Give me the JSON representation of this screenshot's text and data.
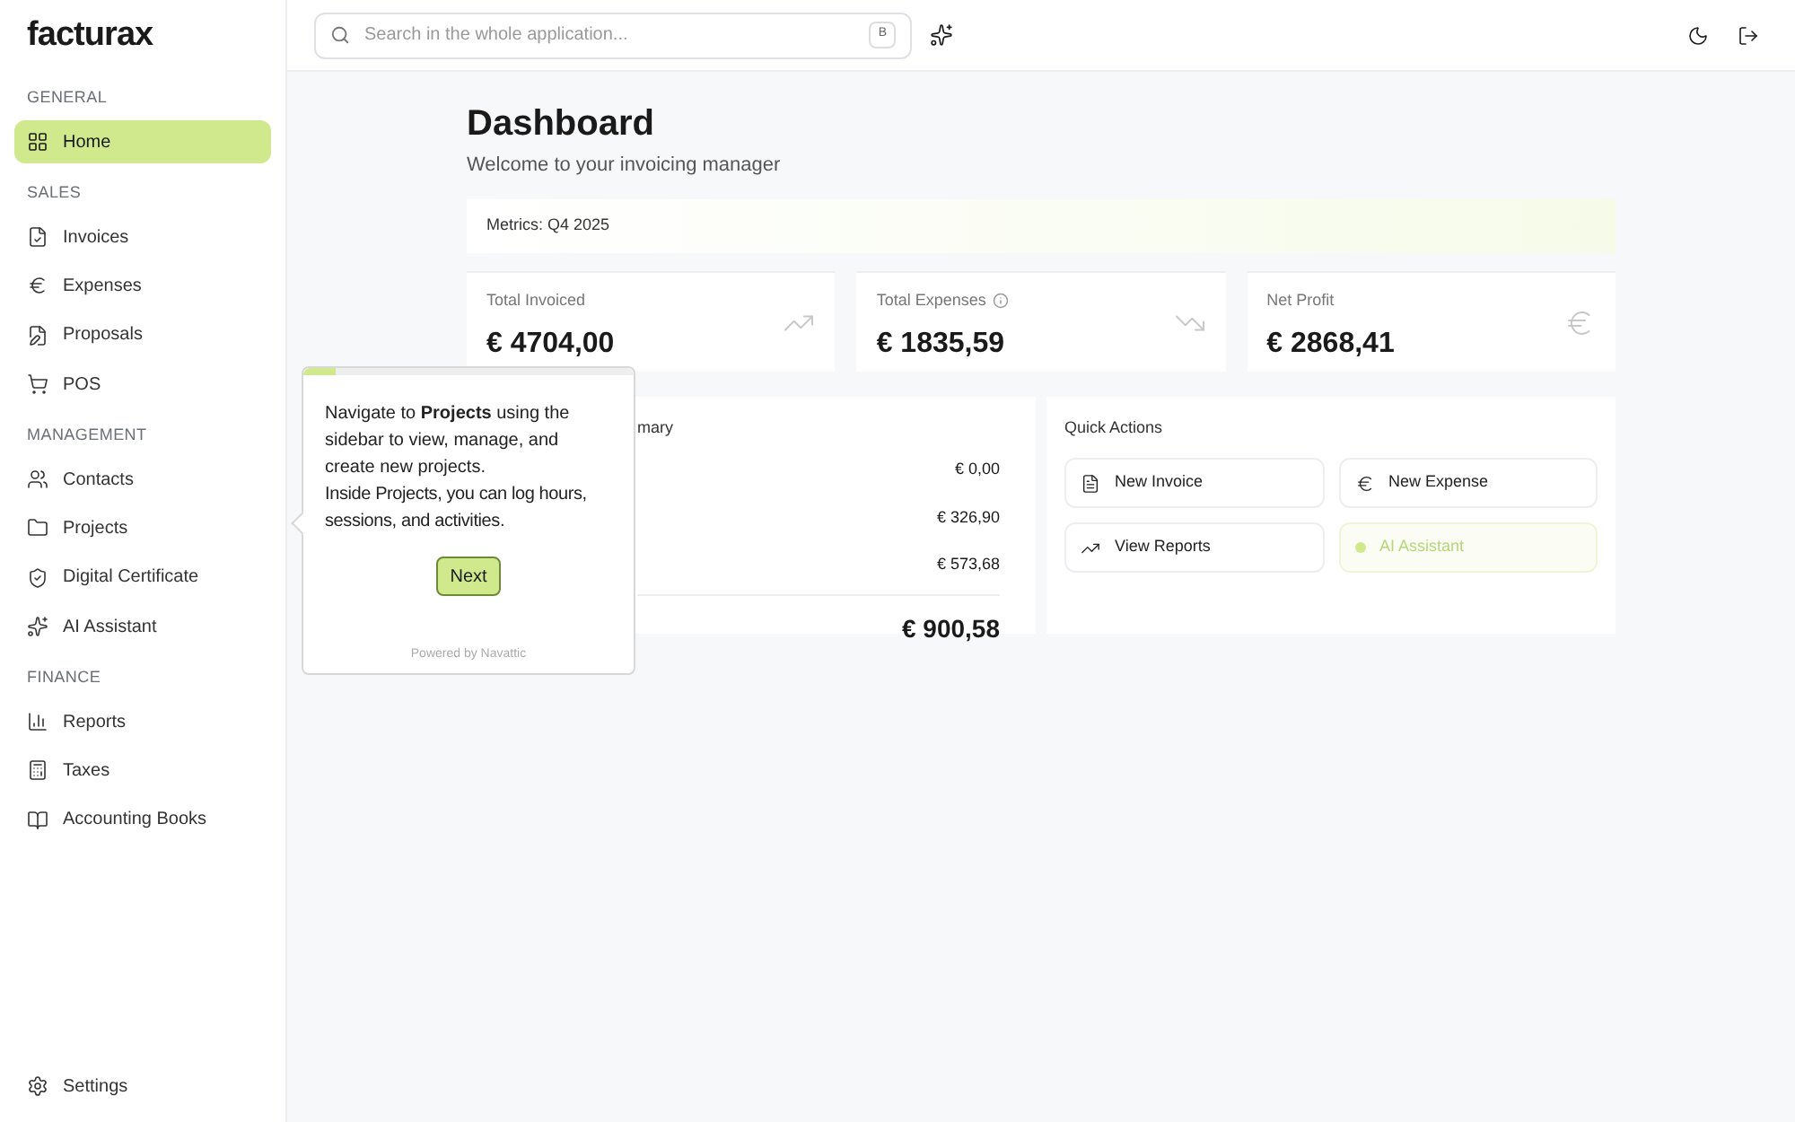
{
  "logo": "facturax",
  "search": {
    "placeholder": "Search in the whole application...",
    "shortcut": "B"
  },
  "sidebar": {
    "sections": [
      {
        "title": "GENERAL",
        "items": [
          {
            "label": "Home",
            "selected": true
          }
        ]
      },
      {
        "title": "SALES",
        "items": [
          {
            "label": "Invoices",
            "selected": false
          },
          {
            "label": "Expenses",
            "selected": false
          },
          {
            "label": "Proposals",
            "selected": false
          },
          {
            "label": "POS",
            "selected": false
          }
        ]
      },
      {
        "title": "MANAGEMENT",
        "items": [
          {
            "label": "Contacts",
            "selected": false
          },
          {
            "label": "Projects",
            "selected": false
          },
          {
            "label": "Digital Certificate",
            "selected": false
          },
          {
            "label": "AI Assistant",
            "selected": false
          }
        ]
      },
      {
        "title": "FINANCE",
        "items": [
          {
            "label": "Reports",
            "selected": false
          },
          {
            "label": "Taxes",
            "selected": false
          },
          {
            "label": "Accounting Books",
            "selected": false
          }
        ]
      }
    ],
    "footer": {
      "label": "Settings"
    }
  },
  "page": {
    "title": "Dashboard",
    "subtitle": "Welcome to your invoicing manager",
    "metrics_label": "Metrics: Q4 2025"
  },
  "metrics": [
    {
      "label": "Total Invoiced",
      "value": "€ 4704,00",
      "info": false
    },
    {
      "label": "Total Expenses",
      "value": "€ 1835,59",
      "info": true
    },
    {
      "label": "Net Profit",
      "value": "€ 2868,41",
      "info": false
    }
  ],
  "summary": {
    "title": "mary",
    "values": [
      "€ 0,00",
      "€ 326,90",
      "€ 573,68"
    ],
    "total": "€ 900,58"
  },
  "quick_actions": {
    "title": "Quick Actions",
    "items": [
      {
        "label": "New Invoice",
        "highlighted": false
      },
      {
        "label": "New Expense",
        "highlighted": false
      },
      {
        "label": "View Reports",
        "highlighted": false
      },
      {
        "label": "AI Assistant",
        "highlighted": true
      }
    ]
  },
  "tour": {
    "text": "Navigate to **Projects** using the sidebar to view, manage, and create new projects.",
    "text2": "Inside Projects, you can log hours, sessions, and activities.",
    "button": "Next",
    "footer": "Powered by Navattic",
    "level": 0.1
  }
}
